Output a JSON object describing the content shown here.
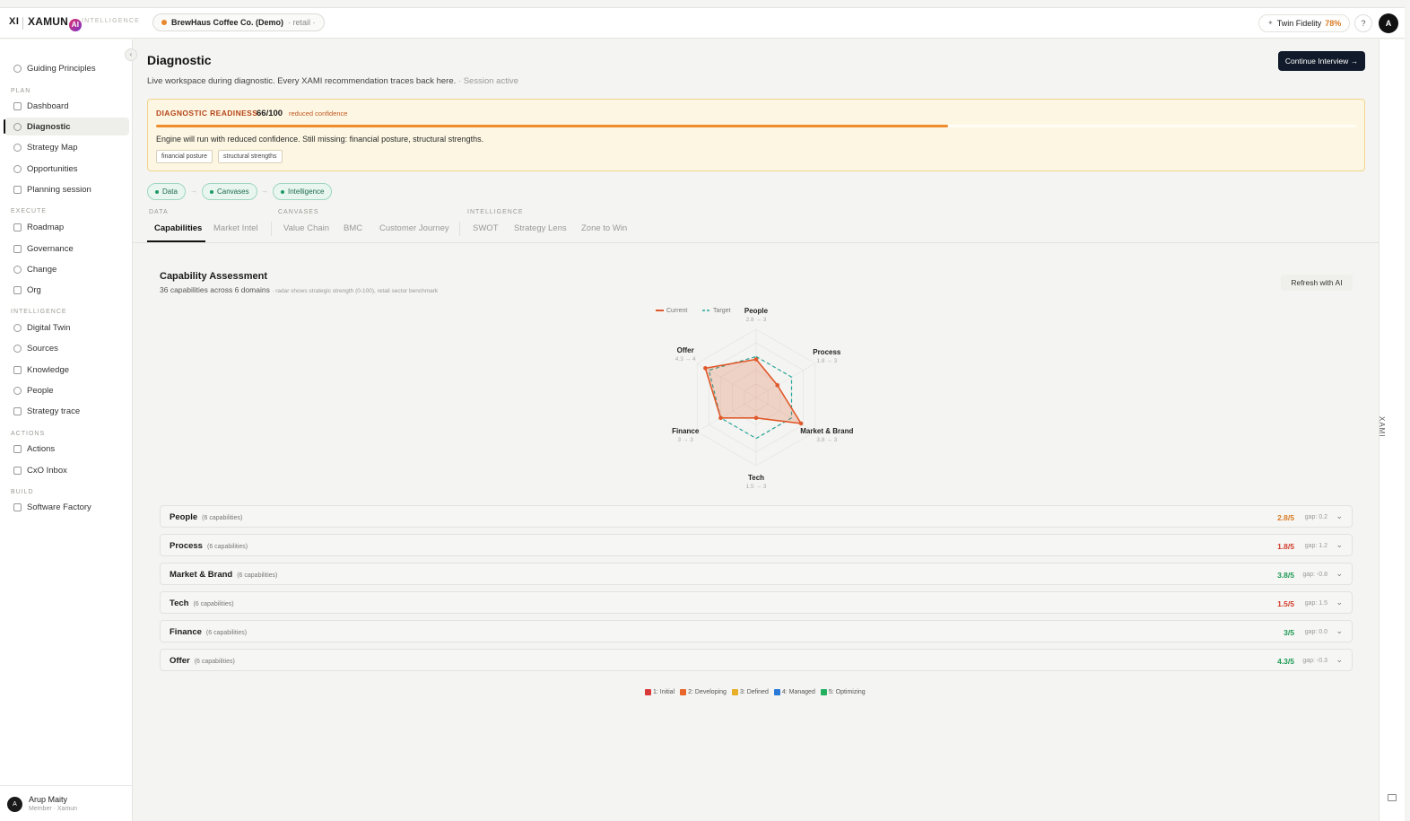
{
  "topbar": {
    "xi": "XI",
    "brand": "XAMUN",
    "brand_ai": "AI",
    "brand_tag": "INTELLIGENCE",
    "company_name": "BrewHaus Coffee Co. (Demo)",
    "company_sector": "· retail ·",
    "fidelity_label": "Twin Fidelity",
    "fidelity_value": "78%",
    "help": "?",
    "avatar": "A"
  },
  "sidebar": {
    "top_item": "Guiding Principles",
    "sections": {
      "plan": "PLAN",
      "execute": "EXECUTE",
      "intelligence": "INTELLIGENCE",
      "actions": "ACTIONS",
      "build": "BUILD"
    },
    "items": {
      "dashboard": "Dashboard",
      "diagnostic": "Diagnostic",
      "strategy_map": "Strategy Map",
      "opportunities": "Opportunities",
      "planning_session": "Planning session",
      "roadmap": "Roadmap",
      "governance": "Governance",
      "change": "Change",
      "org": "Org",
      "digital_twin": "Digital Twin",
      "sources": "Sources",
      "knowledge": "Knowledge",
      "people": "People",
      "strategy_trace": "Strategy trace",
      "actions": "Actions",
      "cxo_inbox": "CxO Inbox",
      "software_factory": "Software Factory"
    },
    "user": {
      "initial": "A",
      "name": "Arup Maity",
      "role": "Member · Xamun"
    }
  },
  "rail": {
    "label": "XAMI"
  },
  "header": {
    "title": "Diagnostic",
    "subtitle": "Live workspace during diagnostic. Every XAMI recommendation traces back here.",
    "session": "· Session active",
    "continue": "Continue Interview →"
  },
  "readiness": {
    "label": "DIAGNOSTIC READINESS",
    "score": "66/100",
    "confidence": "reduced confidence",
    "progress": 0.66,
    "message": "Engine will run with reduced confidence. Still missing: financial posture, structural strengths.",
    "tags": [
      "financial posture",
      "structural strengths"
    ]
  },
  "pipeline": [
    "Data",
    "Canvases",
    "Intelligence"
  ],
  "tab_groups": {
    "data": "DATA",
    "canvases": "CANVASES",
    "intelligence": "INTELLIGENCE"
  },
  "tabs": {
    "capabilities": "Capabilities",
    "market_intel": "Market Intel",
    "value_chain": "Value Chain",
    "bmc": "BMC",
    "customer_journey": "Customer Journey",
    "swot": "SWOT",
    "strategy_lens": "Strategy Lens",
    "zone_to_win": "Zone to Win"
  },
  "capability": {
    "title": "Capability Assessment",
    "subtitle": "36 capabilities across 6 domains",
    "note": "· radar shows strategic strength (0-100), retail sector benchmark",
    "refresh": "Refresh with AI"
  },
  "chart_data": {
    "type": "radar",
    "scale_max": 5,
    "series": [
      {
        "name": "Current",
        "color": "#e0592a",
        "values": [
          2.8,
          1.8,
          3.8,
          1.5,
          3,
          4.3
        ]
      },
      {
        "name": "Target",
        "color": "#22a698",
        "values": [
          3,
          3,
          3,
          3,
          3,
          4
        ]
      }
    ],
    "axes": [
      {
        "label": "People",
        "sub": "2.8 → 3"
      },
      {
        "label": "Process",
        "sub": "1.8 → 3"
      },
      {
        "label": "Market & Brand",
        "sub": "3.8 → 3"
      },
      {
        "label": "Tech",
        "sub": "1.5 → 3"
      },
      {
        "label": "Finance",
        "sub": "3 → 3"
      },
      {
        "label": "Offer",
        "sub": "4.3 → 4"
      }
    ]
  },
  "domains": [
    {
      "name": "People",
      "count": "(6 capabilities)",
      "score": "2.8/5",
      "gap": "gap: 0.2",
      "color": "#d97a22"
    },
    {
      "name": "Process",
      "count": "(6 capabilities)",
      "score": "1.8/5",
      "gap": "gap: 1.2",
      "color": "#d23a2a"
    },
    {
      "name": "Market & Brand",
      "count": "(6 capabilities)",
      "score": "3.8/5",
      "gap": "gap: -0.8",
      "color": "#1c9a54"
    },
    {
      "name": "Tech",
      "count": "(6 capabilities)",
      "score": "1.5/5",
      "gap": "gap: 1.5",
      "color": "#d23a2a"
    },
    {
      "name": "Finance",
      "count": "(6 capabilities)",
      "score": "3/5",
      "gap": "gap: 0.0",
      "color": "#1c9a54"
    },
    {
      "name": "Offer",
      "count": "(6 capabilities)",
      "score": "4.3/5",
      "gap": "gap: -0.3",
      "color": "#1c9a54"
    }
  ],
  "maturity_legend": [
    {
      "label": "1: Initial",
      "color": "#d83a3a"
    },
    {
      "label": "2: Developing",
      "color": "#e8662a"
    },
    {
      "label": "3: Defined",
      "color": "#e8b02a"
    },
    {
      "label": "4: Managed",
      "color": "#2a7ad8"
    },
    {
      "label": "5: Optimizing",
      "color": "#22b060"
    }
  ]
}
